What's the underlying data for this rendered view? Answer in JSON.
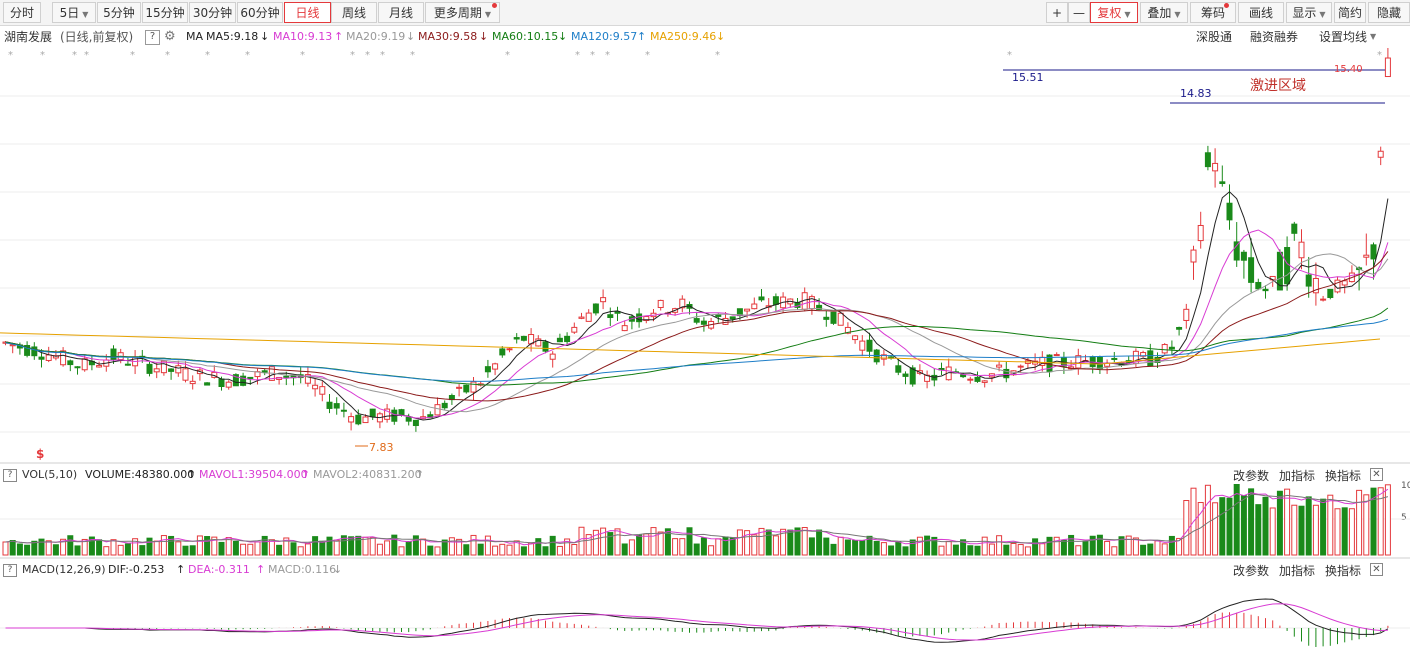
{
  "toolbar": {
    "periods": [
      {
        "label": "分时",
        "active": false,
        "arrow": false
      },
      {
        "label": "5日",
        "active": false,
        "arrow": true
      },
      {
        "label": "5分钟",
        "active": false,
        "arrow": false
      },
      {
        "label": "15分钟",
        "active": false,
        "arrow": false
      },
      {
        "label": "30分钟",
        "active": false,
        "arrow": false
      },
      {
        "label": "60分钟",
        "active": false,
        "arrow": false
      },
      {
        "label": "日线",
        "active": true,
        "arrow": false
      },
      {
        "label": "周线",
        "active": false,
        "arrow": false
      },
      {
        "label": "月线",
        "active": false,
        "arrow": false
      },
      {
        "label": "更多周期",
        "active": false,
        "arrow": true
      }
    ],
    "zoom_in": "+",
    "zoom_out": "—",
    "fuquan": "复权",
    "overlay": "叠加",
    "chips": "筹码",
    "draw": "画线",
    "display": "显示",
    "simple": "简约",
    "hide": "隐藏"
  },
  "info": {
    "stock_name": "湖南发展",
    "mode": "(日线,前复权)",
    "help": "?",
    "ma_label": "MA",
    "ma5": "MA5:9.18",
    "ma10": "MA10:9.13",
    "ma20": "MA20:9.19",
    "ma30": "MA30:9.58",
    "ma60": "MA60:10.15",
    "ma120": "MA120:9.57",
    "ma250": "MA250:9.46",
    "arrow_down": "↓",
    "arrow_up": "↑",
    "shengutong": "深股通",
    "rongzi": "融资融券",
    "ma_settings": "设置均线"
  },
  "annotations": {
    "line1": "15.51",
    "line2": "14.83",
    "zone": "激进区域",
    "high": "15.40",
    "low": "7.83",
    "dollar": "$"
  },
  "volume": {
    "label": "VOL(5,10)",
    "volume": "VOLUME:48380.000",
    "mavol1": "MAVOL1:39504.000",
    "mavol2": "MAVOL2:40831.200",
    "axis_top": "10",
    "axis_mid": "5"
  },
  "macd": {
    "label": "MACD(12,26,9)",
    "dif": "DIF:-0.253",
    "dea": "DEA:-0.311",
    "macd": "MACD:0.116"
  },
  "panel_actions": {
    "change_params": "改参数",
    "add_indicator": "加指标",
    "swap_indicator": "换指标",
    "close": "✕"
  },
  "colors": {
    "up": "#e4393c",
    "down": "#1a8a1a",
    "ma5": "#222222",
    "ma10": "#d83bd3",
    "ma20": "#999999",
    "ma30": "#8b1a1a",
    "ma60": "#137d13",
    "ma120": "#1e7ec8",
    "ma250": "#e6a100",
    "accent": "#e4393c"
  },
  "chart_data": {
    "type": "candlestick",
    "y_range": [
      7.0,
      15.8
    ],
    "ticks": [
      "7.83",
      "15.40"
    ],
    "notes": "stylized reconstruction of daily K-line with MA lines, volume and MACD panels"
  }
}
